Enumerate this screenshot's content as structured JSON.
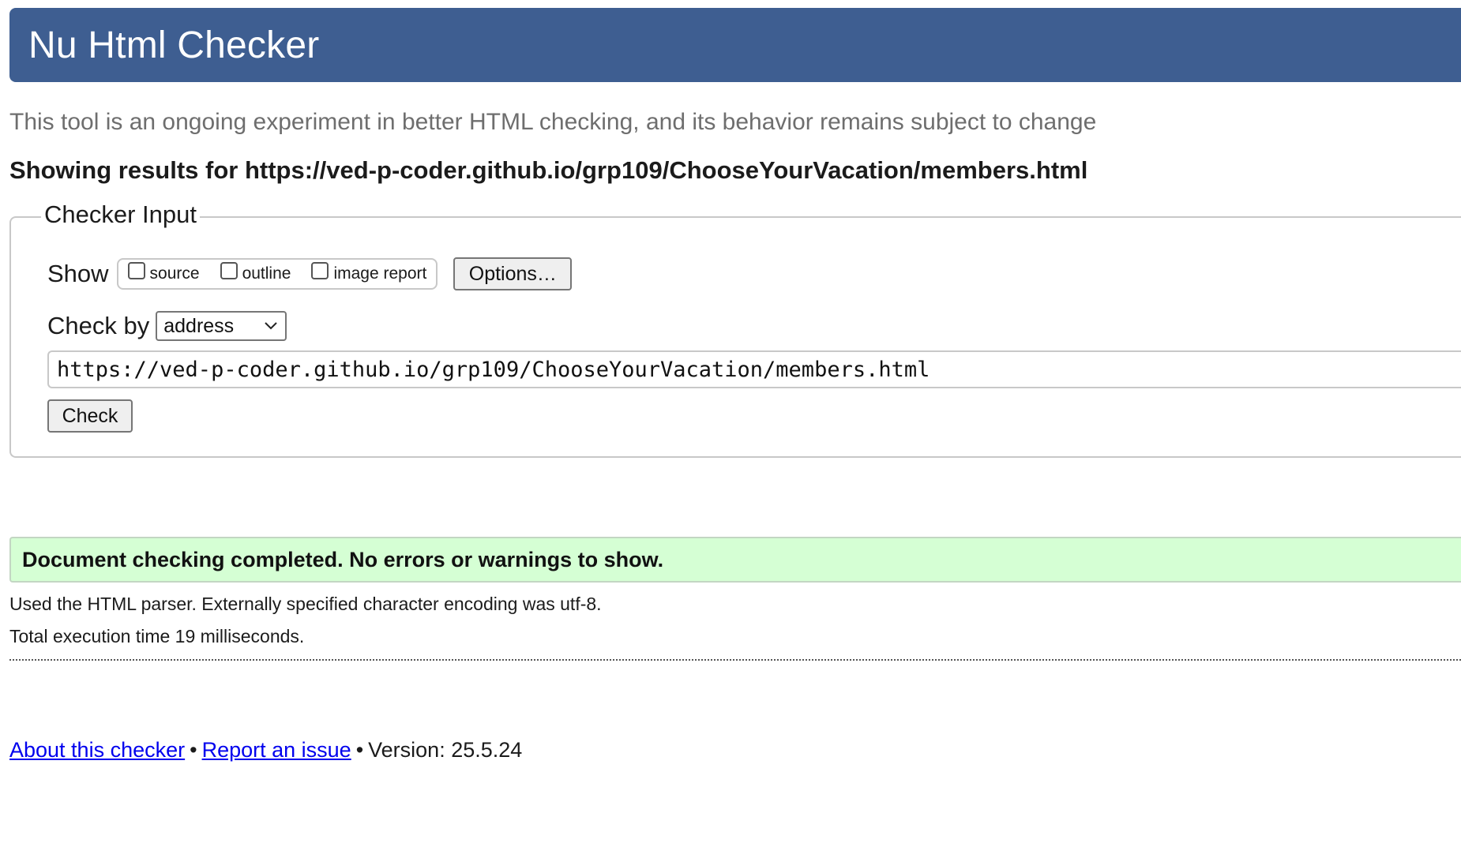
{
  "header": {
    "title": "Nu Html Checker"
  },
  "tagline": "This tool is an ongoing experiment in better HTML checking, and its behavior remains subject to change",
  "results_for": "Showing results for https://ved-p-coder.github.io/grp109/ChooseYourVacation/members.html",
  "checker_input": {
    "legend": "Checker Input",
    "show_label": "Show",
    "show_options": [
      {
        "label": "source",
        "checked": false
      },
      {
        "label": "outline",
        "checked": false
      },
      {
        "label": "image report",
        "checked": false
      }
    ],
    "options_button": "Options…",
    "check_by_label": "Check by",
    "check_by_value": "address",
    "url_value": "https://ved-p-coder.github.io/grp109/ChooseYourVacation/members.html",
    "check_button": "Check"
  },
  "result": {
    "message": "Document checking completed. No errors or warnings to show.",
    "parser_note": "Used the HTML parser. Externally specified character encoding was utf-8.",
    "execution_time": "Total execution time 19 milliseconds."
  },
  "footer": {
    "about_link": "About this checker",
    "separator": "•",
    "report_link": "Report an issue",
    "version": "Version: 25.5.24"
  },
  "colors": {
    "header_bg": "#3e5e91",
    "success_bg": "#d5ffd4",
    "link": "#0000ee"
  }
}
